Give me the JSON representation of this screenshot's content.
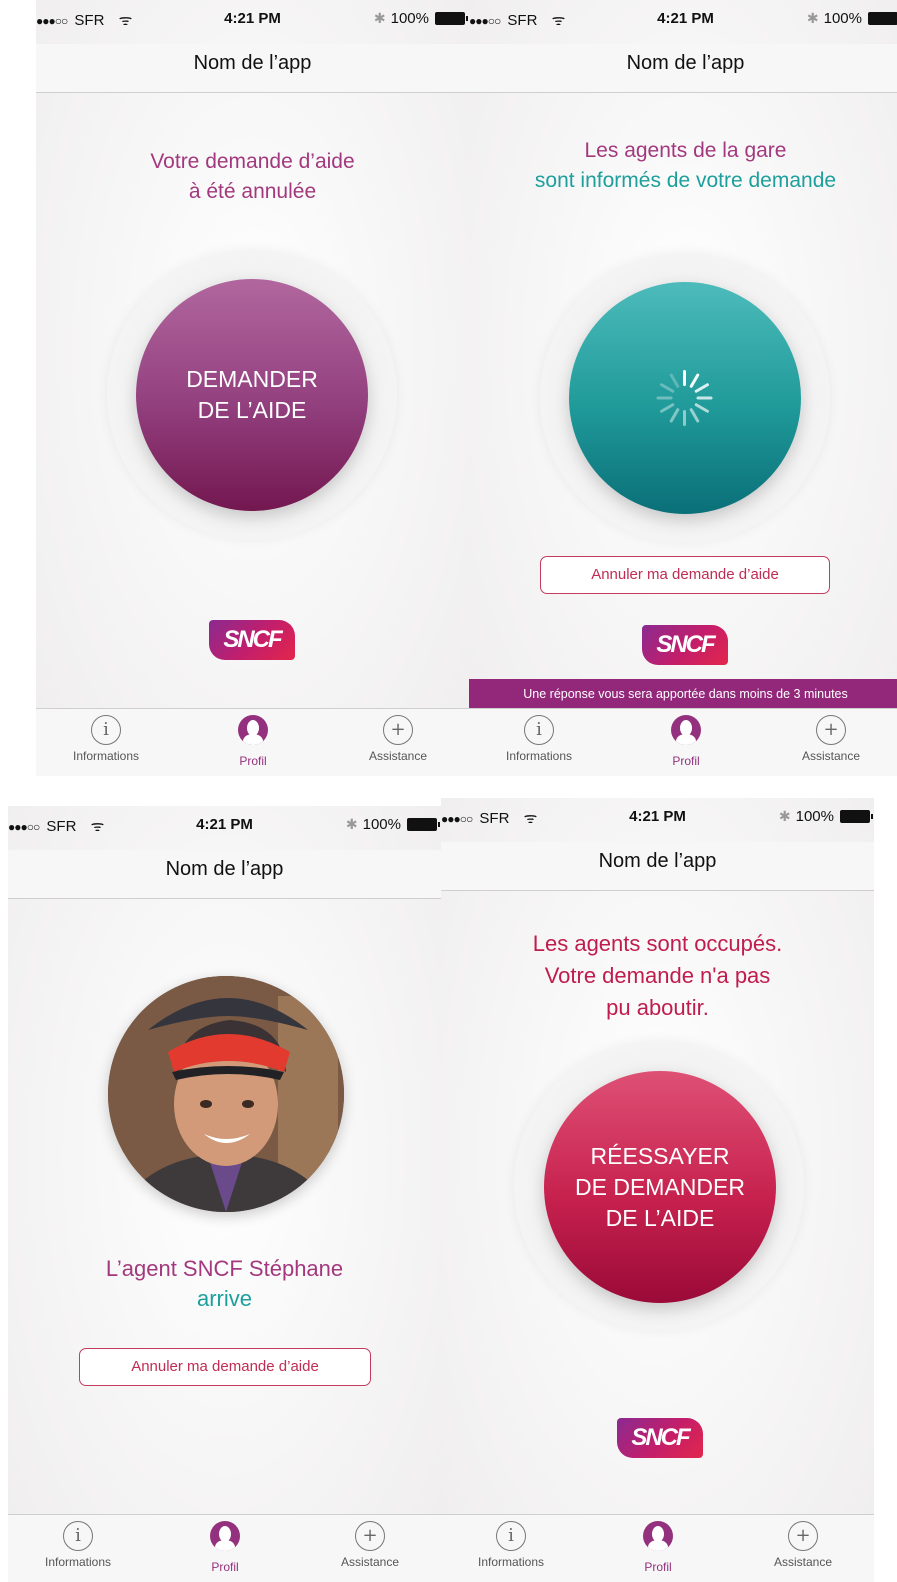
{
  "status_bar": {
    "carrier": "SFR",
    "time": "4:21 PM",
    "battery": "100%"
  },
  "nav": {
    "title": "Nom de l’app"
  },
  "tabs": {
    "informations": "Informations",
    "profil": "Profil",
    "assistance": "Assistance"
  },
  "logo_text": "SNCF",
  "screens": {
    "cancelled": {
      "message_line1": "Votre demande d’aide",
      "message_line2": "à été annulée",
      "button_line1": "DEMANDER",
      "button_line2": "DE L’AIDE"
    },
    "informed": {
      "message_line1": "Les agents de la gare",
      "message_line2": "sont informés de votre demande",
      "cancel_button": "Annuler ma demande d’aide",
      "banner": "Une réponse vous sera apportée dans moins de 3 minutes"
    },
    "arriving": {
      "message_line1": "L’agent SNCF Stéphane",
      "message_line2": "arrive",
      "cancel_button": "Annuler ma demande d’aide"
    },
    "busy": {
      "message_line1": "Les agents sont occupés.",
      "message_line2": "Votre demande n'a pas",
      "message_line3": "pu aboutir.",
      "button_line1": "RÉESSAYER",
      "button_line2": "DE DEMANDER",
      "button_line3": "DE L’AIDE"
    }
  },
  "colors": {
    "purple": "#a2397e",
    "teal": "#1d9f9d",
    "crimson": "#bf1d4e",
    "banner": "#93277a"
  }
}
